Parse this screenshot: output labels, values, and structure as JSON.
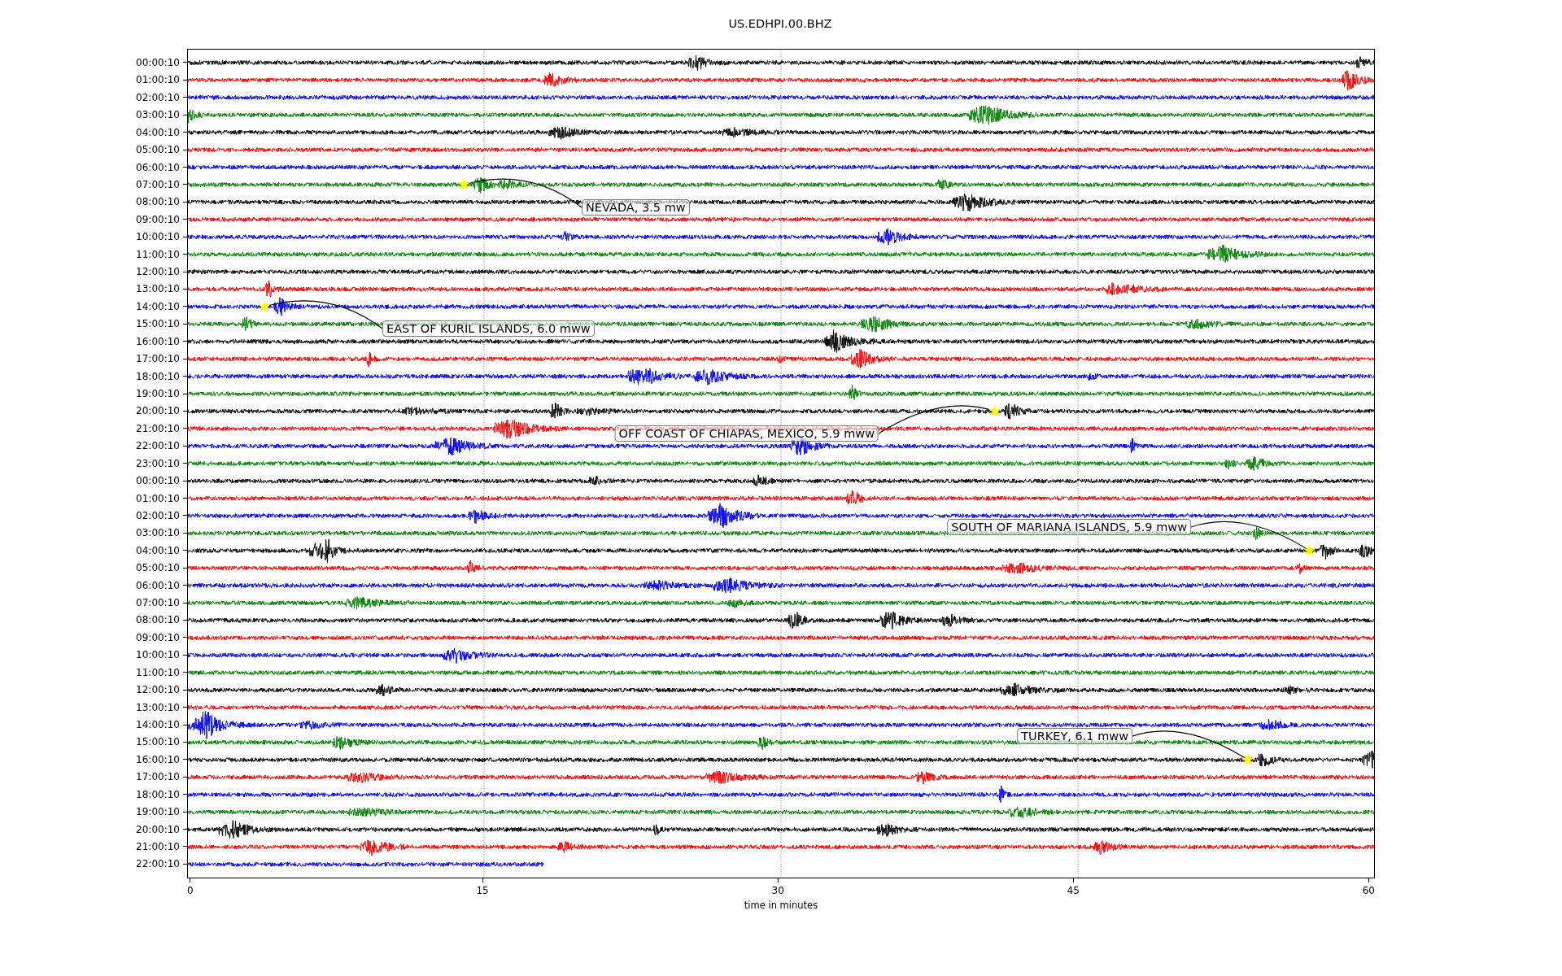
{
  "title": "US.EDHPI.00.BHZ",
  "rows": [
    {
      "label": "00:00:10",
      "color": "#000000",
      "level": 1
    },
    {
      "label": "01:00:10",
      "color": "#ff0000",
      "level": 1
    },
    {
      "label": "02:00:10",
      "color": "#0000ff",
      "level": 1
    },
    {
      "label": "03:00:10",
      "color": "#008000",
      "level": 1
    },
    {
      "label": "04:00:10",
      "color": "#000000",
      "level": 1
    },
    {
      "label": "05:00:10",
      "color": "#ff0000",
      "level": 1
    },
    {
      "label": "06:00:10",
      "color": "#0000ff",
      "level": 1
    },
    {
      "label": "07:00:10",
      "color": "#008000",
      "level": 1,
      "event": {
        "label": "NEVADA, 3.5 mw"
      }
    },
    {
      "label": "08:00:10",
      "color": "#000000",
      "level": 1
    },
    {
      "label": "09:00:10",
      "color": "#ff0000",
      "level": 1
    },
    {
      "label": "10:00:10",
      "color": "#0000ff",
      "level": 1
    },
    {
      "label": "11:00:10",
      "color": "#008000",
      "level": 1
    },
    {
      "label": "12:00:10",
      "color": "#000000",
      "level": 1
    },
    {
      "label": "13:00:10",
      "color": "#ff0000",
      "level": 1
    },
    {
      "label": "14:00:10",
      "color": "#0000ff",
      "level": 1,
      "event": {
        "label": "EAST OF KURIL ISLANDS, 6.0 mww"
      }
    },
    {
      "label": "15:00:10",
      "color": "#008000",
      "level": 1
    },
    {
      "label": "16:00:10",
      "color": "#000000",
      "level": 1
    },
    {
      "label": "17:00:10",
      "color": "#ff0000",
      "level": 1
    },
    {
      "label": "18:00:10",
      "color": "#0000ff",
      "level": 1
    },
    {
      "label": "19:00:10",
      "color": "#008000",
      "level": 1
    },
    {
      "label": "20:00:10",
      "color": "#000000",
      "level": 1,
      "event": {
        "label": "OFF COAST OF CHIAPAS, MEXICO, 5.9 mww"
      }
    },
    {
      "label": "21:00:10",
      "color": "#ff0000",
      "level": 1
    },
    {
      "label": "22:00:10",
      "color": "#0000ff",
      "level": 1
    },
    {
      "label": "23:00:10",
      "color": "#008000",
      "level": 1
    },
    {
      "label": "00:00:10",
      "color": "#000000",
      "level": 1
    },
    {
      "label": "01:00:10",
      "color": "#ff0000",
      "level": 1
    },
    {
      "label": "02:00:10",
      "color": "#0000ff",
      "level": 1
    },
    {
      "label": "03:00:10",
      "color": "#008000",
      "level": 1
    },
    {
      "label": "04:00:10",
      "color": "#000000",
      "level": 1,
      "event": {
        "label": "SOUTH OF MARIANA ISLANDS, 5.9 mww"
      }
    },
    {
      "label": "05:00:10",
      "color": "#ff0000",
      "level": 1
    },
    {
      "label": "06:00:10",
      "color": "#0000ff",
      "level": 1
    },
    {
      "label": "07:00:10",
      "color": "#008000",
      "level": 1
    },
    {
      "label": "08:00:10",
      "color": "#000000",
      "level": 1
    },
    {
      "label": "09:00:10",
      "color": "#ff0000",
      "level": 1
    },
    {
      "label": "10:00:10",
      "color": "#0000ff",
      "level": 1
    },
    {
      "label": "11:00:10",
      "color": "#008000",
      "level": 1
    },
    {
      "label": "12:00:10",
      "color": "#000000",
      "level": 1
    },
    {
      "label": "13:00:10",
      "color": "#ff0000",
      "level": 1
    },
    {
      "label": "14:00:10",
      "color": "#0000ff",
      "level": 1
    },
    {
      "label": "15:00:10",
      "color": "#008000",
      "level": 1
    },
    {
      "label": "16:00:10",
      "color": "#000000",
      "level": 1,
      "event": {
        "label": "TURKEY, 6.1 mww"
      }
    },
    {
      "label": "17:00:10",
      "color": "#ff0000",
      "level": 1
    },
    {
      "label": "18:00:10",
      "color": "#0000ff",
      "level": 1
    },
    {
      "label": "19:00:10",
      "color": "#008000",
      "level": 1
    },
    {
      "label": "20:00:10",
      "color": "#000000",
      "level": 1
    },
    {
      "label": "21:00:10",
      "color": "#ff0000",
      "level": 1
    },
    {
      "label": "22:00:10",
      "color": "#0000ff",
      "level": 0.3
    }
  ],
  "x_axis": {
    "ticks": [
      "0",
      "15",
      "30",
      "45",
      "60"
    ],
    "label": "time in minutes"
  }
}
